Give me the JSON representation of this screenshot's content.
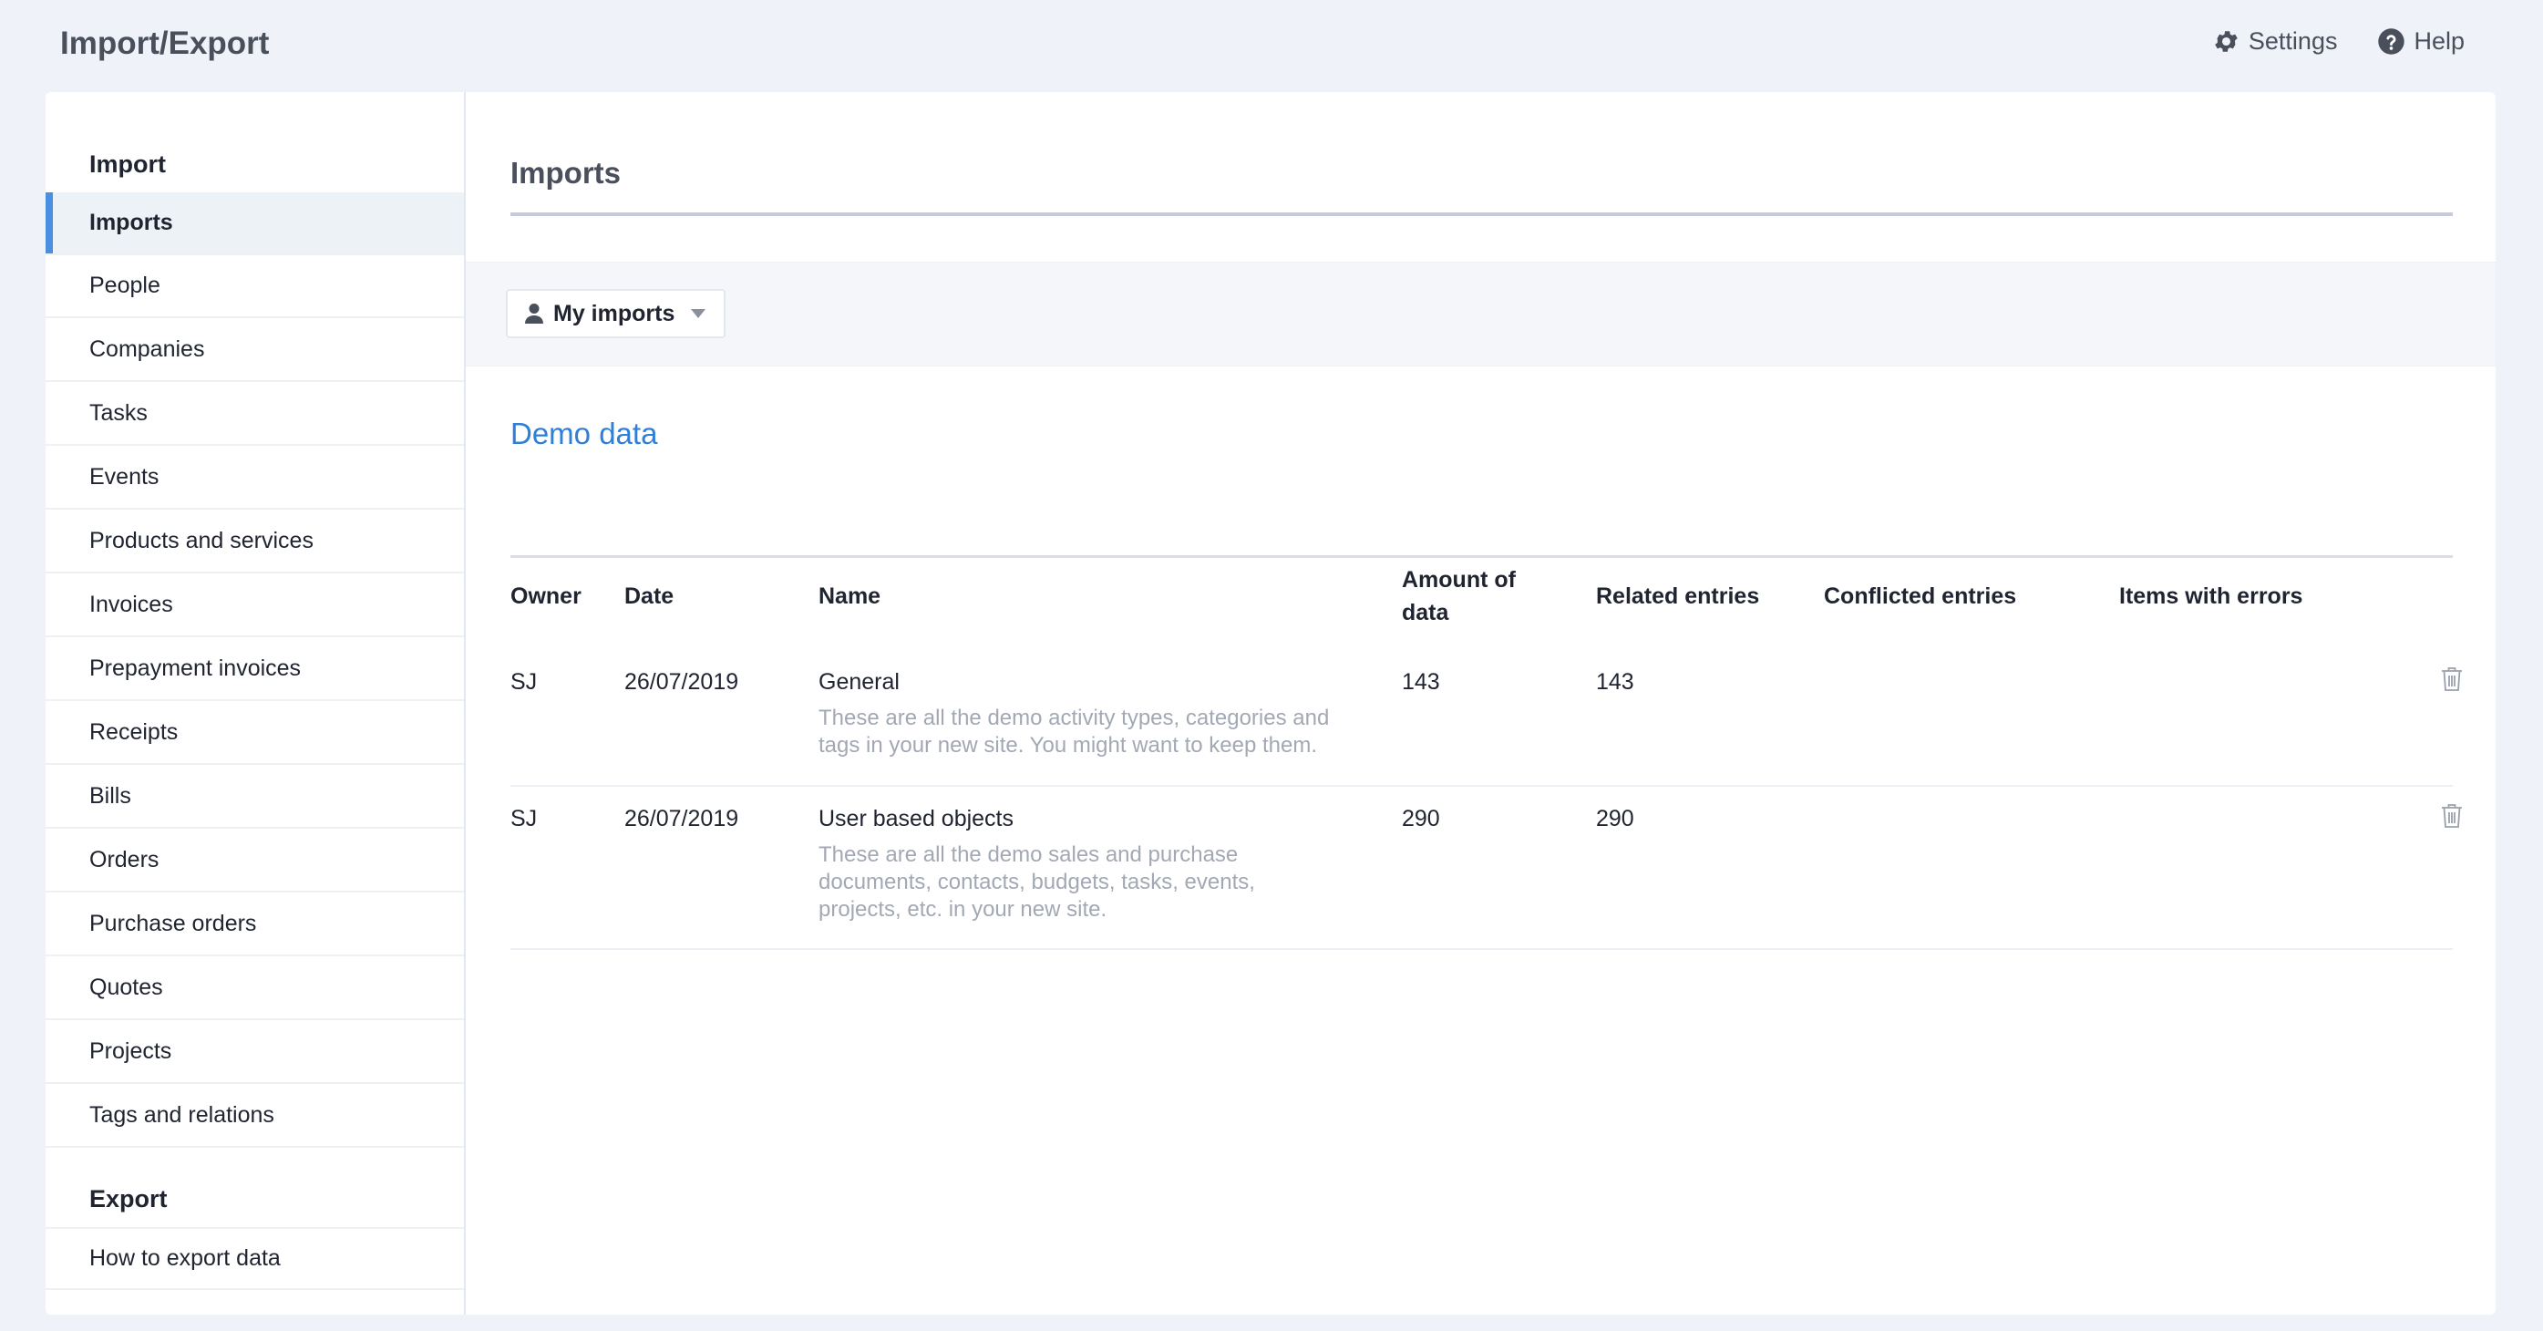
{
  "app": {
    "title": "Import/Export"
  },
  "top_actions": {
    "settings_label": "Settings",
    "help_label": "Help"
  },
  "sidebar": {
    "import_heading": "Import",
    "items": [
      {
        "label": "Imports",
        "active": true
      },
      {
        "label": "People"
      },
      {
        "label": "Companies"
      },
      {
        "label": "Tasks"
      },
      {
        "label": "Events"
      },
      {
        "label": "Products and services"
      },
      {
        "label": "Invoices"
      },
      {
        "label": "Prepayment invoices"
      },
      {
        "label": "Receipts"
      },
      {
        "label": "Bills"
      },
      {
        "label": "Orders"
      },
      {
        "label": "Purchase orders"
      },
      {
        "label": "Quotes"
      },
      {
        "label": "Projects"
      },
      {
        "label": "Tags and relations"
      }
    ],
    "export_heading": "Export",
    "export_items": [
      {
        "label": "How to export data"
      }
    ]
  },
  "main": {
    "title": "Imports",
    "filter": {
      "label": "My imports",
      "icon": "user-icon"
    },
    "section_title": "Demo data",
    "columns": {
      "owner": "Owner",
      "date": "Date",
      "name": "Name",
      "amount_line1": "Amount of",
      "amount_line2": "data",
      "related": "Related entries",
      "conflicted": "Conflicted entries",
      "errors": "Items with errors"
    },
    "rows": [
      {
        "owner": "SJ",
        "date": "26/07/2019",
        "name": "General",
        "desc_lines": [
          "These are all the demo activity types, categories and",
          "tags in your new site. You might want to keep them."
        ],
        "amount": "143",
        "related": "143",
        "conflicted": "",
        "errors": ""
      },
      {
        "owner": "SJ",
        "date": "26/07/2019",
        "name": "User based objects",
        "desc_lines": [
          "These are all the demo sales and purchase",
          "documents, contacts, budgets, tasks, events,",
          "projects, etc. in your new site."
        ],
        "amount": "290",
        "related": "290",
        "conflicted": "",
        "errors": ""
      }
    ]
  },
  "colors": {
    "accent": "#4a8fe0",
    "link": "#2f7fd8",
    "muted_text": "#a2a8b4",
    "page_bg": "#eff2f8"
  }
}
